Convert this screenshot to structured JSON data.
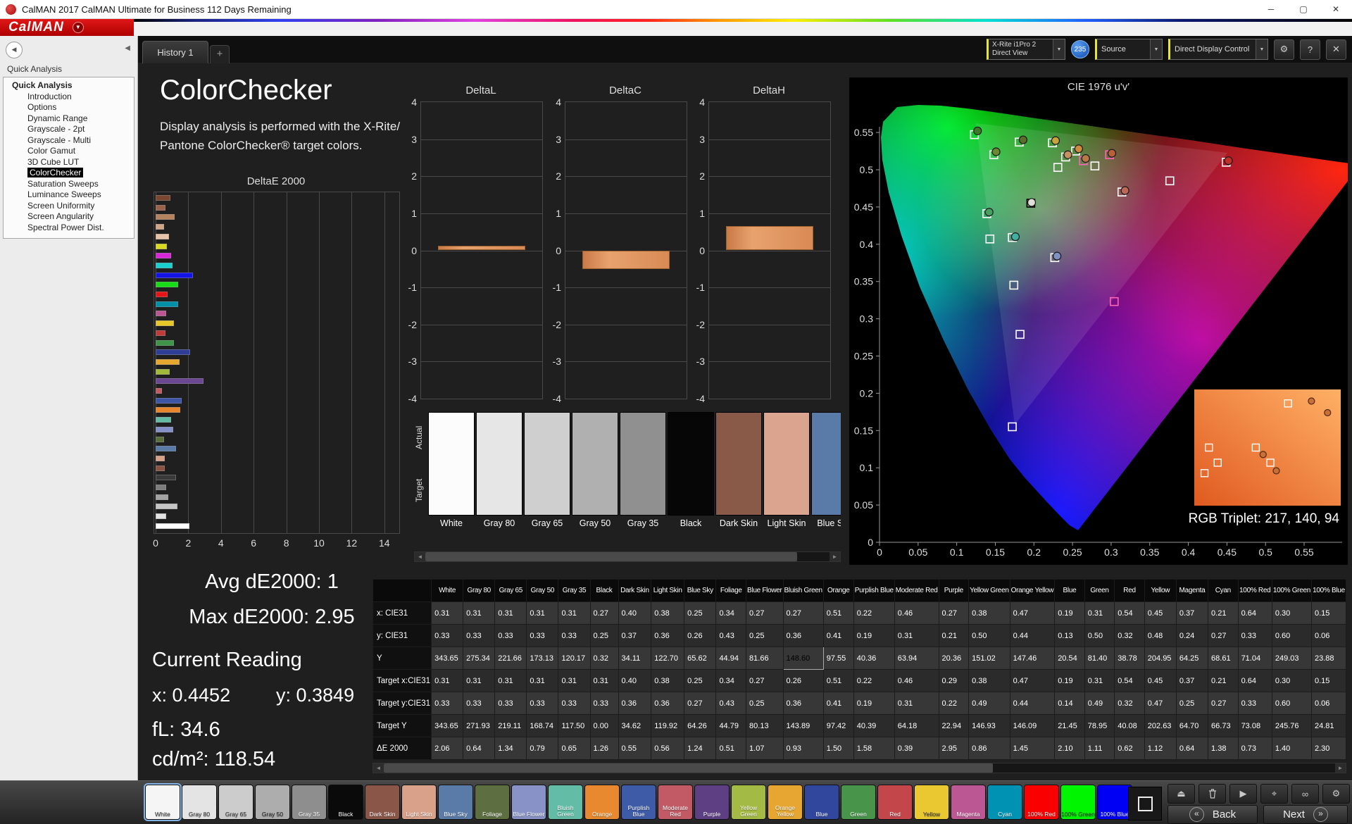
{
  "window": {
    "title": "CalMAN 2017 CalMAN Ultimate for Business 112 Days Remaining"
  },
  "logo": {
    "text": "CalMAN"
  },
  "tabs": {
    "active": "History 1"
  },
  "icons": {
    "dropdown": "▼",
    "collapse": "◀",
    "minimize": "─",
    "maximize": "▢",
    "close": "✕",
    "gear": "⚙",
    "help": "?",
    "add_tab": "+",
    "back_chevron": "«",
    "next_chevron": "»",
    "scroll_left": "◄",
    "scroll_right": "►",
    "play": "▶",
    "eject": "⏏",
    "target": "⌖",
    "infinity": "∞"
  },
  "topbar": {
    "meter": {
      "line1": "X-Rite i1Pro 2",
      "line2": "Direct View"
    },
    "badge": "235",
    "source": "Source",
    "display_control": "Direct Display Control"
  },
  "sidebar": {
    "header": "Quick Analysis",
    "items": [
      {
        "label": "Quick Analysis",
        "level": 0,
        "bold": true
      },
      {
        "label": "Introduction",
        "level": 1
      },
      {
        "label": "Options",
        "level": 1
      },
      {
        "label": "Dynamic Range",
        "level": 1
      },
      {
        "label": "Grayscale - 2pt",
        "level": 1
      },
      {
        "label": "Grayscale - Multi",
        "level": 1
      },
      {
        "label": "Color Gamut",
        "level": 1
      },
      {
        "label": "3D Cube LUT",
        "level": 1
      },
      {
        "label": "ColorChecker",
        "level": 1,
        "selected": true
      },
      {
        "label": "Saturation Sweeps",
        "level": 1
      },
      {
        "label": "Luminance Sweeps",
        "level": 1
      },
      {
        "label": "Screen Uniformity",
        "level": 1
      },
      {
        "label": "Screen Angularity",
        "level": 1
      },
      {
        "label": "Spectral Power Dist.",
        "level": 1
      }
    ]
  },
  "page": {
    "title": "ColorChecker",
    "description_line1": "Display analysis is performed with the X-Rite/",
    "description_line2": "Pantone ColorChecker® target colors."
  },
  "stats": {
    "avg": "Avg dE2000: 1",
    "max": "Max dE2000: 2.95",
    "current": "Current Reading",
    "x": "x: 0.4452",
    "y": "y: 0.3849",
    "fl": "fL: 34.6",
    "cd": "cd/m²: 118.54"
  },
  "chart_data": [
    {
      "type": "bar",
      "orientation": "horizontal",
      "title": "DeltaE 2000",
      "xlim": [
        0,
        14
      ],
      "xticks": [
        0,
        2,
        4,
        6,
        8,
        10,
        12,
        14
      ],
      "bars": [
        {
          "color": "#7a4631",
          "value": 0.9
        },
        {
          "color": "#9a6248",
          "value": 0.6
        },
        {
          "color": "#b5825f",
          "value": 1.15
        },
        {
          "color": "#d3a588",
          "value": 0.5
        },
        {
          "color": "#e8c3a8",
          "value": 0.8
        },
        {
          "color": "#d9d920",
          "value": 0.7
        },
        {
          "color": "#d926d9",
          "value": 0.95
        },
        {
          "color": "#19cfcf",
          "value": 1.05
        },
        {
          "color": "#1414e6",
          "value": 2.3
        },
        {
          "color": "#17dc17",
          "value": 1.4
        },
        {
          "color": "#e61414",
          "value": 0.73
        },
        {
          "color": "#0090a8",
          "value": 1.38
        },
        {
          "color": "#bc5692",
          "value": 0.64
        },
        {
          "color": "#e8c829",
          "value": 1.12
        },
        {
          "color": "#c03a38",
          "value": 0.62
        },
        {
          "color": "#3e9448",
          "value": 1.11
        },
        {
          "color": "#2e3e96",
          "value": 2.1
        },
        {
          "color": "#e6a82e",
          "value": 1.45
        },
        {
          "color": "#a2ba3a",
          "value": 0.86
        },
        {
          "color": "#6a4693",
          "value": 2.95
        },
        {
          "color": "#c25a64",
          "value": 0.39
        },
        {
          "color": "#3c55a6",
          "value": 1.58
        },
        {
          "color": "#e8862e",
          "value": 1.5
        },
        {
          "color": "#62bca4",
          "value": 0.93
        },
        {
          "color": "#8490c8",
          "value": 1.07
        },
        {
          "color": "#5a6e3c",
          "value": 0.51
        },
        {
          "color": "#5a7ba6",
          "value": 1.24
        },
        {
          "color": "#d8a089",
          "value": 0.56
        },
        {
          "color": "#8a5243",
          "value": 0.55
        },
        {
          "color": "#3a3a3a",
          "value": 1.26
        },
        {
          "color": "#7c7c7c",
          "value": 0.65
        },
        {
          "color": "#a2a2a2",
          "value": 0.79
        },
        {
          "color": "#c6c6c6",
          "value": 1.34
        },
        {
          "color": "#e3e3e3",
          "value": 0.64
        },
        {
          "color": "#ffffff",
          "value": 2.06
        }
      ]
    },
    {
      "type": "bar",
      "title": "DeltaL",
      "ylim": [
        -4,
        4
      ],
      "yticks": [
        4,
        3,
        2,
        1,
        0,
        -1,
        -2,
        -3,
        -4
      ],
      "values": [
        0.12
      ],
      "bar_color": "#dd9265"
    },
    {
      "type": "bar",
      "title": "DeltaC",
      "ylim": [
        -4,
        4
      ],
      "yticks": [
        4,
        3,
        2,
        1,
        0,
        -1,
        -2,
        -3,
        -4
      ],
      "values": [
        -0.5
      ],
      "bar_color": "#dd9265"
    },
    {
      "type": "bar",
      "title": "DeltaH",
      "ylim": [
        -4,
        4
      ],
      "yticks": [
        4,
        3,
        2,
        1,
        0,
        -1,
        -2,
        -3,
        -4
      ],
      "values": [
        0.65
      ],
      "bar_color": "#dd9265"
    },
    {
      "type": "scatter",
      "title": "CIE 1976 u'v'",
      "xlim": [
        0,
        0.55
      ],
      "ylim": [
        0,
        0.55
      ],
      "xticks": [
        "0",
        "0.05",
        "0.1",
        "0.15",
        "0.2",
        "0.25",
        "0.3",
        "0.35",
        "0.4",
        "0.45",
        "0.5",
        "0.55"
      ],
      "yticks": [
        "0",
        "0.05",
        "0.1",
        "0.15",
        "0.2",
        "0.25",
        "0.3",
        "0.35",
        "0.4",
        "0.45",
        "0.5",
        "0.55"
      ],
      "targets": [
        [
          0.123,
          0.547
        ],
        [
          0.148,
          0.52
        ],
        [
          0.181,
          0.537
        ],
        [
          0.224,
          0.536
        ],
        [
          0.254,
          0.525
        ],
        [
          0.298,
          0.52,
          "#ff64b4"
        ],
        [
          0.279,
          0.505
        ],
        [
          0.231,
          0.503
        ],
        [
          0.241,
          0.517
        ],
        [
          0.264,
          0.512,
          "#ff64b4"
        ],
        [
          0.449,
          0.51
        ],
        [
          0.376,
          0.485
        ],
        [
          0.314,
          0.47
        ],
        [
          0.196,
          0.455,
          "#000000"
        ],
        [
          0.139,
          0.441
        ],
        [
          0.143,
          0.407
        ],
        [
          0.172,
          0.409
        ],
        [
          0.227,
          0.382
        ],
        [
          0.174,
          0.345
        ],
        [
          0.304,
          0.323,
          "#ff64b4"
        ],
        [
          0.182,
          0.279
        ],
        [
          0.172,
          0.155
        ]
      ],
      "measured": [
        [
          0.127,
          0.552,
          "#3c7a28"
        ],
        [
          0.151,
          0.524,
          "#6b8a2e"
        ],
        [
          0.186,
          0.54,
          "#5a6e2a"
        ],
        [
          0.228,
          0.539,
          "#c8a43c"
        ],
        [
          0.258,
          0.528,
          "#d08a3c"
        ],
        [
          0.301,
          0.522,
          "#b86038"
        ],
        [
          0.244,
          0.52,
          "#c89060"
        ],
        [
          0.267,
          0.515,
          "#b87848"
        ],
        [
          0.452,
          0.512,
          "#c03028"
        ],
        [
          0.318,
          0.472,
          "#c06858"
        ],
        [
          0.197,
          0.456,
          "#e0e0d8"
        ],
        [
          0.142,
          0.443,
          "#48a060"
        ],
        [
          0.176,
          0.41,
          "#40b0a0"
        ],
        [
          0.23,
          0.384,
          "#8090c0"
        ]
      ],
      "inset": {
        "label": "RGB Triplet: 217, 140, 94",
        "squares": [
          [
            0.1,
            0.5
          ],
          [
            0.16,
            0.63
          ],
          [
            0.07,
            0.72
          ],
          [
            0.42,
            0.5
          ],
          [
            0.52,
            0.63
          ],
          [
            0.64,
            0.12
          ]
        ],
        "circles": [
          [
            0.8,
            0.1
          ],
          [
            0.91,
            0.2
          ],
          [
            0.47,
            0.56
          ],
          [
            0.56,
            0.7
          ]
        ]
      }
    }
  ],
  "swatch_strip": {
    "actual_label": "Actual",
    "target_label": "Target",
    "items": [
      {
        "label": "White",
        "color": "#fcfcfc"
      },
      {
        "label": "Gray 80",
        "color": "#e6e6e6"
      },
      {
        "label": "Gray 65",
        "color": "#cfcfcf"
      },
      {
        "label": "Gray 50",
        "color": "#b0b0b0"
      },
      {
        "label": "Gray 35",
        "color": "#909090"
      },
      {
        "label": "Black",
        "color": "#060606"
      },
      {
        "label": "Dark Skin",
        "color": "#8a5a49"
      },
      {
        "label": "Light Skin",
        "color": "#dba48e"
      },
      {
        "label": "Blue Sky",
        "color": "#5a7ba8"
      }
    ]
  },
  "table": {
    "columns": [
      "White",
      "Gray 80",
      "Gray 65",
      "Gray 50",
      "Gray 35",
      "Black",
      "Dark Skin",
      "Light Skin",
      "Blue Sky",
      "Foliage",
      "Blue Flower",
      "Bluish Green",
      "Orange",
      "Purplish Blue",
      "Moderate Red",
      "Purple",
      "Yellow Green",
      "Orange Yellow",
      "Blue",
      "Green",
      "Red",
      "Yellow",
      "Magenta",
      "Cyan",
      "100% Red",
      "100% Green",
      "100% Blue"
    ],
    "highlight": {
      "row": 2,
      "col": 11
    },
    "rows": [
      {
        "label": "x: CIE31",
        "values": [
          "0.31",
          "0.31",
          "0.31",
          "0.31",
          "0.31",
          "0.27",
          "0.40",
          "0.38",
          "0.25",
          "0.34",
          "0.27",
          "0.27",
          "0.51",
          "0.22",
          "0.46",
          "0.27",
          "0.38",
          "0.47",
          "0.19",
          "0.31",
          "0.54",
          "0.45",
          "0.37",
          "0.21",
          "0.64",
          "0.30",
          "0.15"
        ]
      },
      {
        "label": "y: CIE31",
        "values": [
          "0.33",
          "0.33",
          "0.33",
          "0.33",
          "0.33",
          "0.25",
          "0.37",
          "0.36",
          "0.26",
          "0.43",
          "0.25",
          "0.36",
          "0.41",
          "0.19",
          "0.31",
          "0.21",
          "0.50",
          "0.44",
          "0.13",
          "0.50",
          "0.32",
          "0.48",
          "0.24",
          "0.27",
          "0.33",
          "0.60",
          "0.06"
        ]
      },
      {
        "label": "Y",
        "values": [
          "343.65",
          "275.34",
          "221.66",
          "173.13",
          "120.17",
          "0.32",
          "34.11",
          "122.70",
          "65.62",
          "44.94",
          "81.66",
          "148.60",
          "97.55",
          "40.36",
          "63.94",
          "20.36",
          "151.02",
          "147.46",
          "20.54",
          "81.40",
          "38.78",
          "204.95",
          "64.25",
          "68.61",
          "71.04",
          "249.03",
          "23.88"
        ]
      },
      {
        "label": "Target x:CIE31",
        "values": [
          "0.31",
          "0.31",
          "0.31",
          "0.31",
          "0.31",
          "0.31",
          "0.40",
          "0.38",
          "0.25",
          "0.34",
          "0.27",
          "0.26",
          "0.51",
          "0.22",
          "0.46",
          "0.29",
          "0.38",
          "0.47",
          "0.19",
          "0.31",
          "0.54",
          "0.45",
          "0.37",
          "0.21",
          "0.64",
          "0.30",
          "0.15"
        ]
      },
      {
        "label": "Target y:CIE31",
        "values": [
          "0.33",
          "0.33",
          "0.33",
          "0.33",
          "0.33",
          "0.33",
          "0.36",
          "0.36",
          "0.27",
          "0.43",
          "0.25",
          "0.36",
          "0.41",
          "0.19",
          "0.31",
          "0.22",
          "0.49",
          "0.44",
          "0.14",
          "0.49",
          "0.32",
          "0.47",
          "0.25",
          "0.27",
          "0.33",
          "0.60",
          "0.06"
        ]
      },
      {
        "label": "Target Y",
        "values": [
          "343.65",
          "271.93",
          "219.11",
          "168.74",
          "117.50",
          "0.00",
          "34.62",
          "119.92",
          "64.26",
          "44.79",
          "80.13",
          "143.89",
          "97.42",
          "40.39",
          "64.18",
          "22.94",
          "146.93",
          "146.09",
          "21.45",
          "78.95",
          "40.08",
          "202.63",
          "64.70",
          "66.73",
          "73.08",
          "245.76",
          "24.81"
        ]
      },
      {
        "label": "ΔE 2000",
        "values": [
          "2.06",
          "0.64",
          "1.34",
          "0.79",
          "0.65",
          "1.26",
          "0.55",
          "0.56",
          "1.24",
          "0.51",
          "1.07",
          "0.93",
          "1.50",
          "1.58",
          "0.39",
          "2.95",
          "0.86",
          "1.45",
          "2.10",
          "1.11",
          "0.62",
          "1.12",
          "0.64",
          "1.38",
          "0.73",
          "1.40",
          "2.30"
        ]
      }
    ]
  },
  "bottom_swatches": [
    {
      "label": "White",
      "color": "#f5f5f5",
      "text": "#333333"
    },
    {
      "label": "Gray 80",
      "color": "#e4e4e4",
      "text": "#333333"
    },
    {
      "label": "Gray 65",
      "color": "#cccccc",
      "text": "#333333"
    },
    {
      "label": "Gray 50",
      "color": "#adadad",
      "text": "#222222"
    },
    {
      "label": "Gray 35",
      "color": "#8e8e8e",
      "text": "#ffffff"
    },
    {
      "label": "Black",
      "color": "#0a0a0a",
      "text": "#ffffff"
    },
    {
      "label": "Dark Skin",
      "color": "#8a5648",
      "text": "#ffffff"
    },
    {
      "label": "Light Skin",
      "color": "#d9a189",
      "text": "#ffffff"
    },
    {
      "label": "Blue Sky",
      "color": "#5a7ba8",
      "text": "#ffffff"
    },
    {
      "label": "Foliage",
      "color": "#5d6e41",
      "text": "#ffffff"
    },
    {
      "label": "Blue Flower",
      "color": "#8892c6",
      "text": "#ffffff"
    },
    {
      "label": "Bluish Green",
      "color": "#62bca6",
      "text": "#ffffff"
    },
    {
      "label": "Orange",
      "color": "#e8882f",
      "text": "#ffffff"
    },
    {
      "label": "Purplish Blue",
      "color": "#3e5ba8",
      "text": "#ffffff"
    },
    {
      "label": "Moderate Red",
      "color": "#c15a64",
      "text": "#ffffff"
    },
    {
      "label": "Purple",
      "color": "#5e3f84",
      "text": "#ffffff"
    },
    {
      "label": "Yellow Green",
      "color": "#a3ba44",
      "text": "#ffffff"
    },
    {
      "label": "Orange Yellow",
      "color": "#e6a631",
      "text": "#ffffff"
    },
    {
      "label": "Blue",
      "color": "#31479e",
      "text": "#ffffff"
    },
    {
      "label": "Green",
      "color": "#47944a",
      "text": "#ffffff"
    },
    {
      "label": "Red",
      "color": "#c2464a",
      "text": "#ffffff"
    },
    {
      "label": "Yellow",
      "color": "#e9c832",
      "text": "#333333"
    },
    {
      "label": "Magenta",
      "color": "#bb5793",
      "text": "#ffffff"
    },
    {
      "label": "Cyan",
      "color": "#0092b2",
      "text": "#ffffff"
    },
    {
      "label": "100% Red",
      "color": "#fb0000",
      "text": "#ffffff"
    },
    {
      "label": "100% Green",
      "color": "#00f500",
      "text": "#333333"
    },
    {
      "label": "100% Blue",
      "color": "#0000f5",
      "text": "#ffffff"
    }
  ],
  "nav": {
    "back": "Back",
    "next": "Next"
  }
}
